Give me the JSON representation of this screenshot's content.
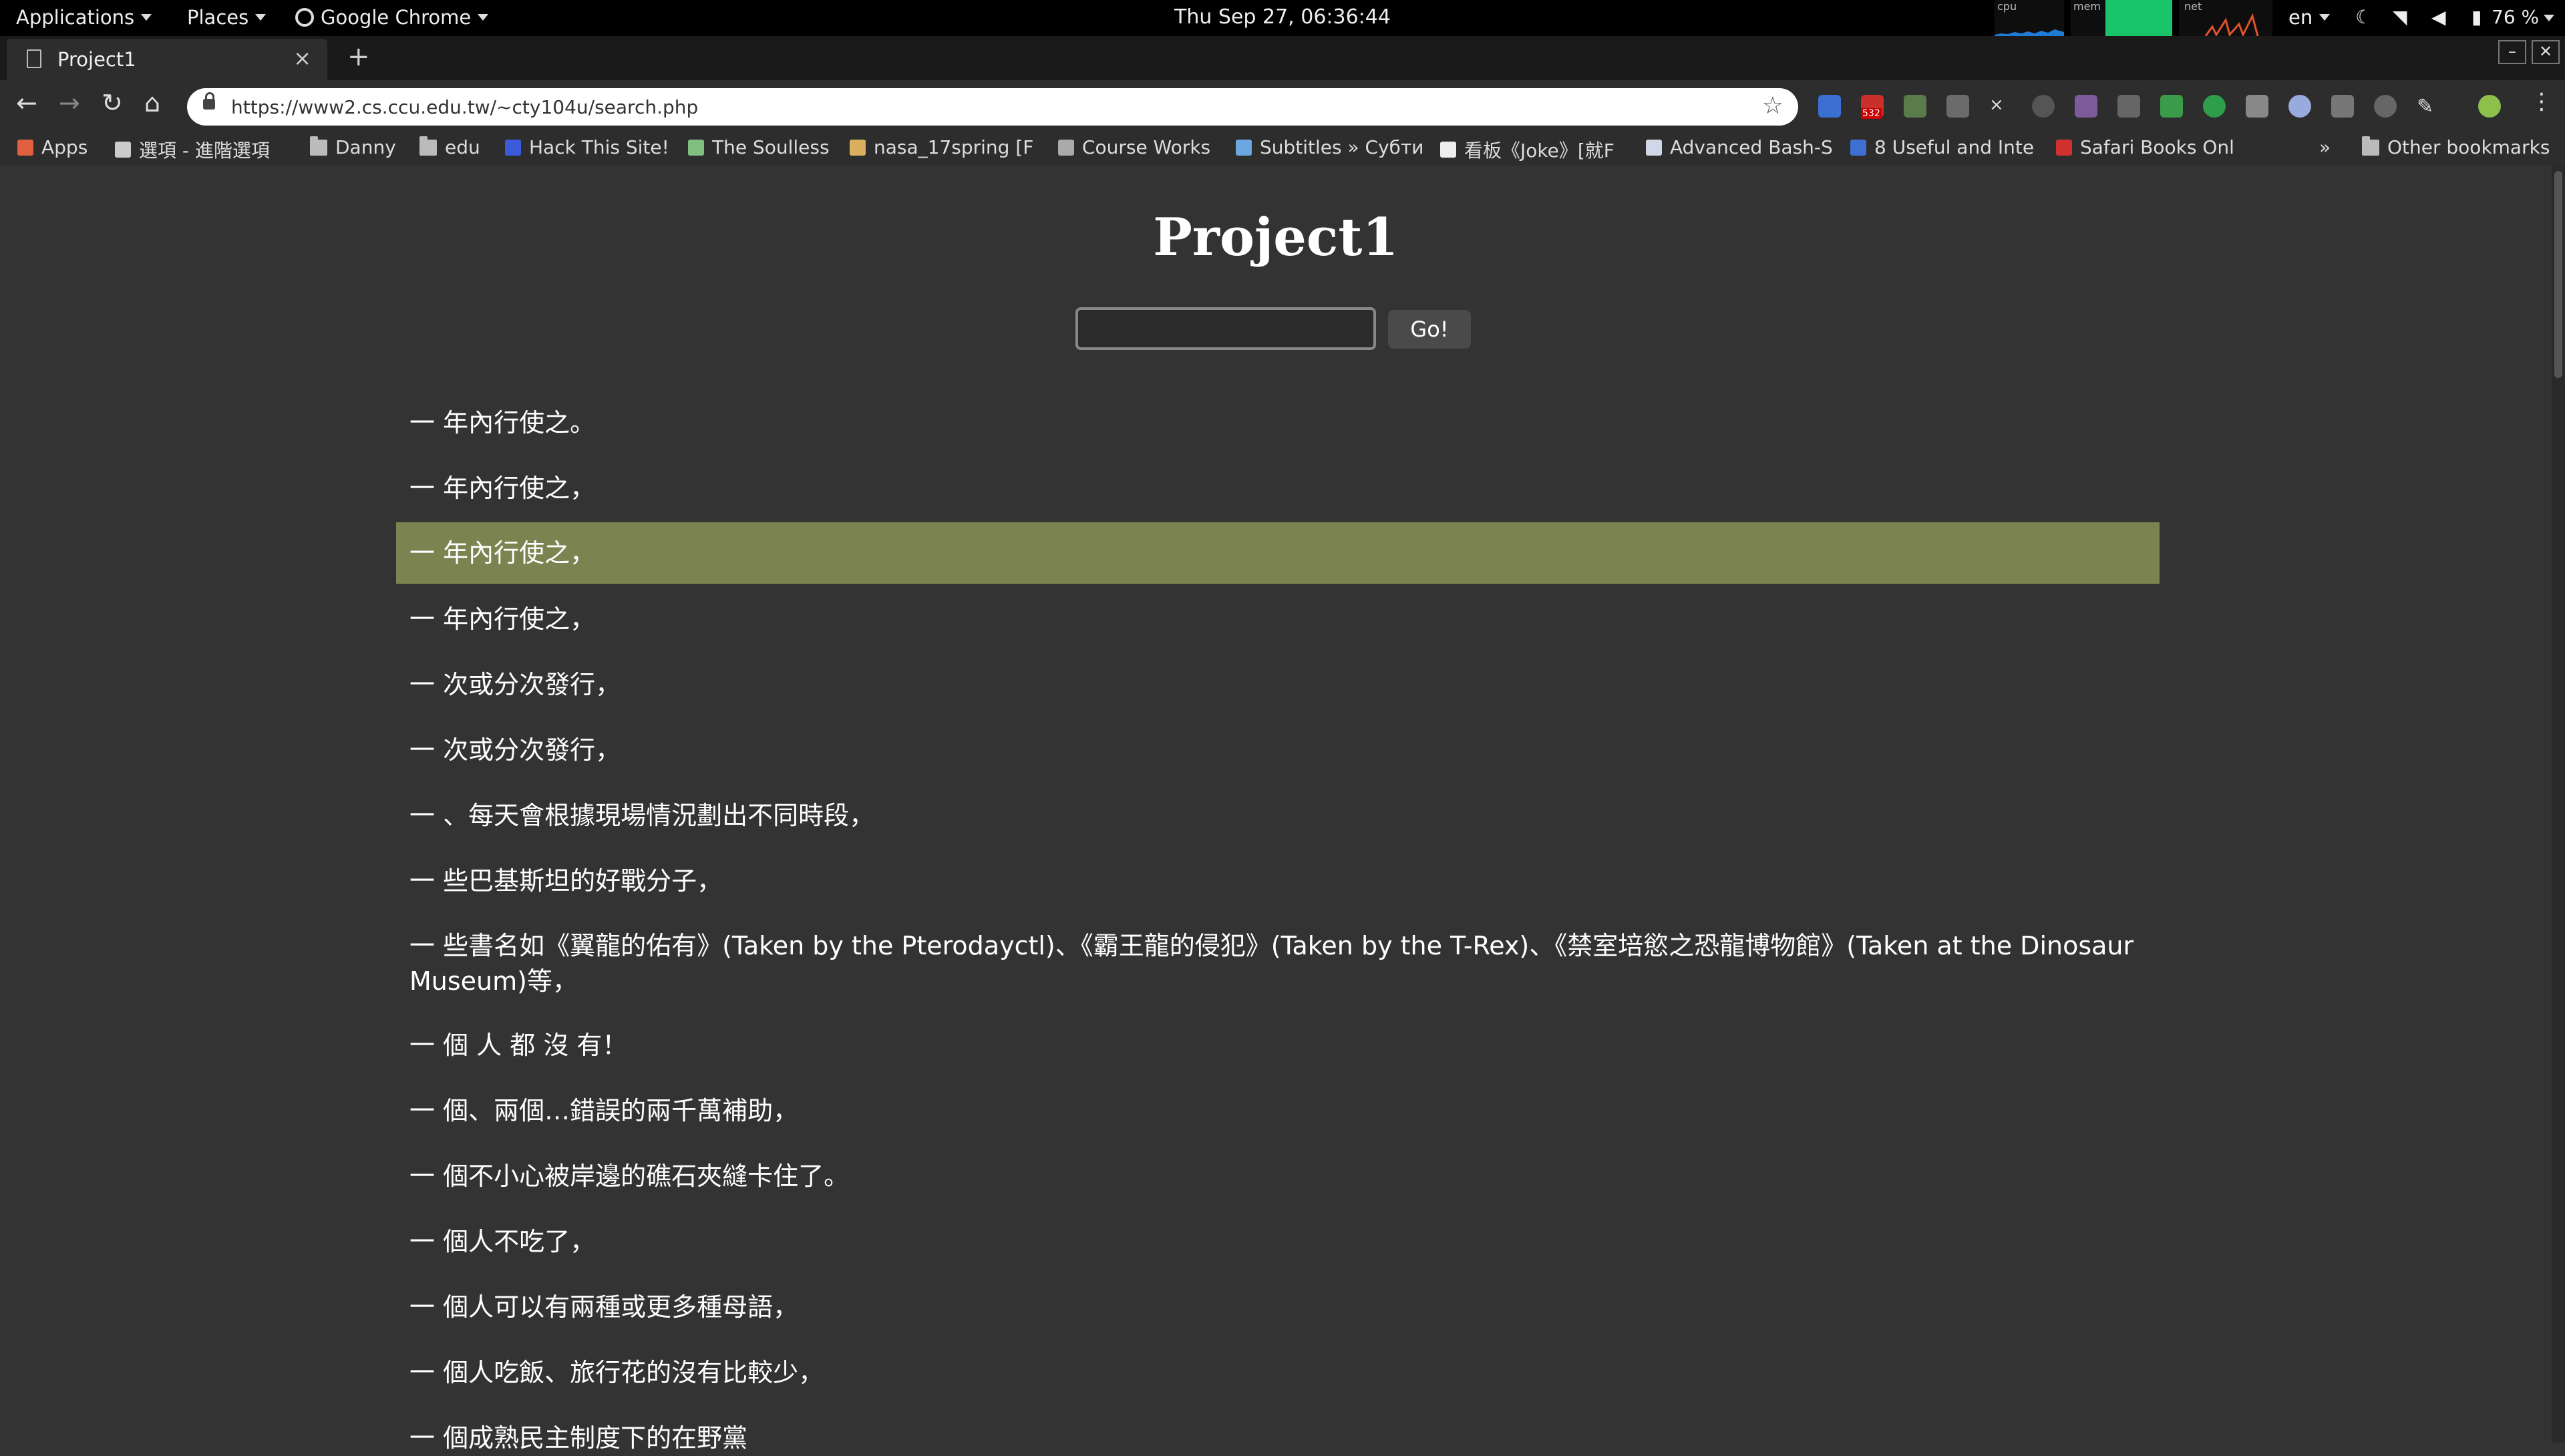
{
  "system_bar": {
    "applications": "Applications",
    "places": "Places",
    "app_name": "Google Chrome",
    "clock": "Thu Sep 27, 06:36:44",
    "monitors": [
      "cpu",
      "mem",
      "net"
    ],
    "language": "en",
    "battery": "76 %"
  },
  "browser": {
    "tab_title": "Project1",
    "url": "https://www2.cs.ccu.edu.tw/~cty104u/search.php",
    "ext_badge_count": "532",
    "bookmarks": [
      {
        "label": "Apps",
        "icon": "apps-grid-icon"
      },
      {
        "label": "選項 - 進階選項",
        "icon": "gear-icon"
      },
      {
        "label": "Danny",
        "icon": "folder-icon"
      },
      {
        "label": "edu",
        "icon": "folder-icon"
      },
      {
        "label": "Hack This Site!",
        "icon": "hts-icon"
      },
      {
        "label": "The Soulless",
        "icon": "leaf-icon"
      },
      {
        "label": "nasa_17spring [F",
        "icon": "pencil-icon"
      },
      {
        "label": "Course Works",
        "icon": "doc-icon"
      },
      {
        "label": "Subtitles » Субти",
        "icon": "subtitles-icon"
      },
      {
        "label": "看板《Joke》[就F",
        "icon": "d-icon"
      },
      {
        "label": "Advanced Bash-S",
        "icon": "window-icon"
      },
      {
        "label": "8 Useful and Inte",
        "icon": "m-icon"
      },
      {
        "label": "Safari Books Onl",
        "icon": "sr-icon"
      }
    ],
    "overflow": "»",
    "other_bookmarks": "Other bookmarks"
  },
  "page": {
    "heading": "Project1",
    "search_value": "",
    "go_label": "Go!",
    "results": [
      "一 年內行使之。",
      "一 年內行使之，",
      "一 年內行使之，",
      "一 年內行使之，",
      "一 次或分次發行，",
      "一 次或分次發行，",
      "一 、每天會根據現場情況劃出不同時段，",
      "一 些巴基斯坦的好戰分子，",
      "一 些書名如《翼龍的佑有》(Taken by the Pterodayctl)、《霸王龍的侵犯》(Taken by the T-Rex)、《禁室培慾之恐龍博物館》(Taken at the Dinosaur Museum)等，",
      "一 個 人 都 沒 有！",
      "一 個、兩個…錯誤的兩千萬補助，",
      "一 個不小心被岸邊的礁石夾縫卡住了。",
      "一 個人不吃了，",
      "一 個人可以有兩種或更多種母語，",
      "一 個人吃飯、旅行花的沒有比較少，",
      "一 個成熟民主制度下的在野黨"
    ],
    "highlighted_index": 2,
    "highlight_color": "#7b8450"
  }
}
